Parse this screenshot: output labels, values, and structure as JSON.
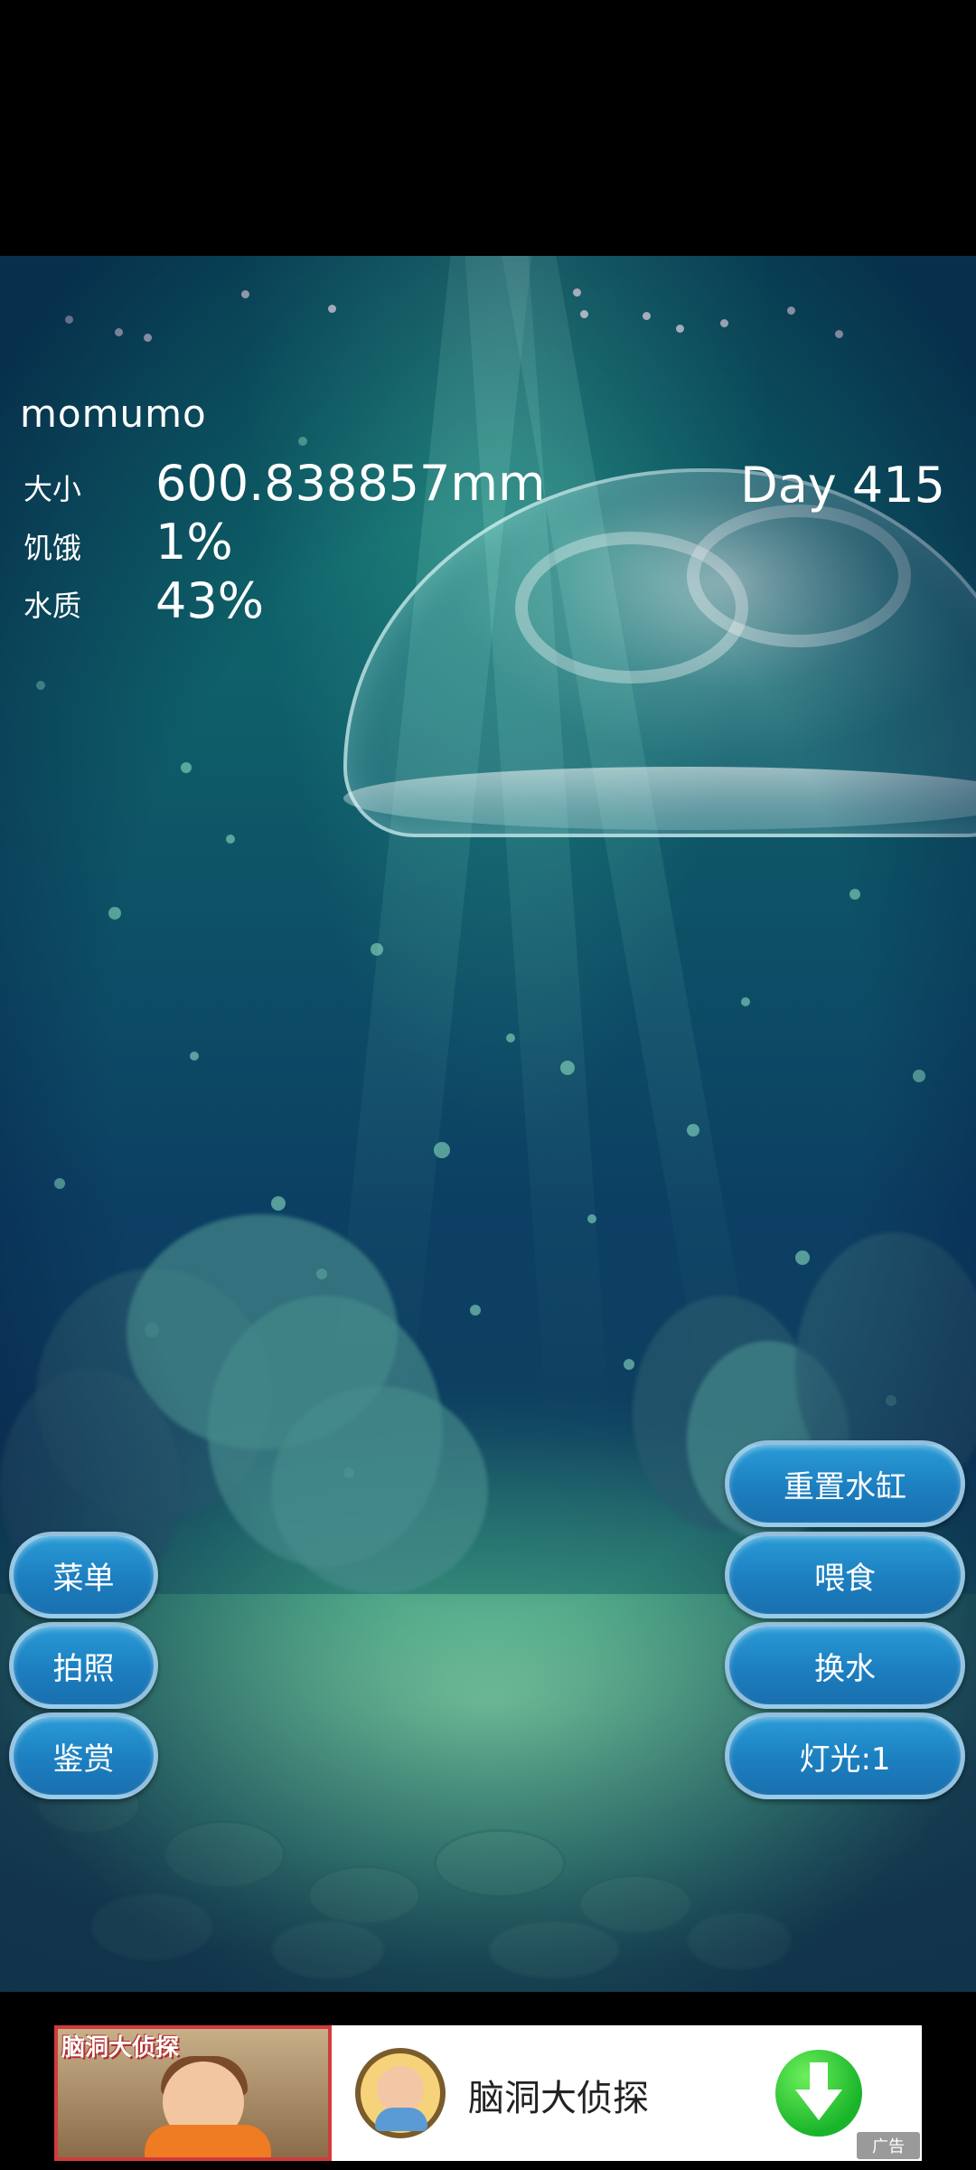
{
  "pet": {
    "name": "momumo",
    "day": "Day 415"
  },
  "stats": {
    "size_label": "大小",
    "size_value": "600.838857mm",
    "hunger_label": "饥饿",
    "hunger_value": "1%",
    "water_label": "水质",
    "water_value": "43%"
  },
  "buttons": {
    "menu": "菜单",
    "photo": "拍照",
    "appreciate": "鉴赏",
    "reset_tank": "重置水缸",
    "feed": "喂食",
    "change_water": "换水",
    "light": "灯光:1"
  },
  "ad": {
    "banner_title": "脑洞大侦探",
    "app_name": "脑洞大侦探",
    "tag": "广告",
    "download_icon": "download-arrow-icon",
    "colors": {
      "download": "#19b42a"
    }
  }
}
